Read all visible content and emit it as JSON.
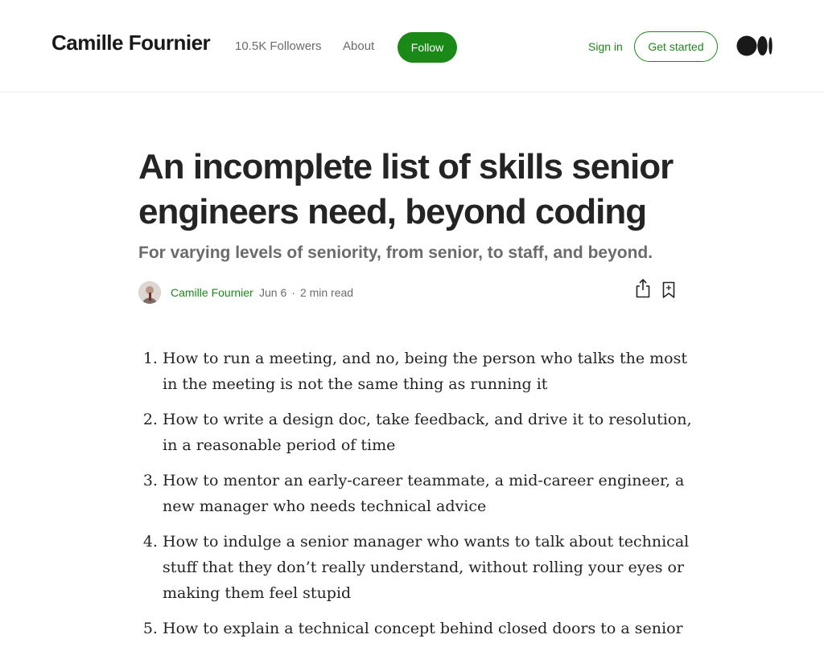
{
  "header": {
    "brand": "Camille Fournier",
    "followers": "10.5K Followers",
    "about": "About",
    "follow": "Follow",
    "sign_in": "Sign in",
    "get_started": "Get started",
    "logo_icon": "medium-logo-icon"
  },
  "colors": {
    "accent": "#1a8917",
    "text": "#242424",
    "muted": "#6b6b6b"
  },
  "article": {
    "title": "An incomplete list of skills senior engineers need, beyond coding",
    "subtitle": "For varying levels of seniority, from senior, to staff, and beyond.",
    "author": "Camille Fournier",
    "date": "Jun 6",
    "separator": "·",
    "read_time": "2 min read",
    "icons": [
      "share-icon",
      "bookmark-icon"
    ],
    "items": [
      "How to run a meeting, and no, being the person who talks the most in the meeting is not the same thing as running it",
      "How to write a design doc, take feedback, and drive it to resolution, in a reasonable period of time",
      "How to mentor an early-career teammate, a mid-career engineer, a new manager who needs technical advice",
      "How to indulge a senior manager who wants to talk about technical stuff that they don’t really understand, without rolling your eyes or making them feel stupid",
      "How to explain a technical concept behind closed doors to a senior"
    ]
  }
}
